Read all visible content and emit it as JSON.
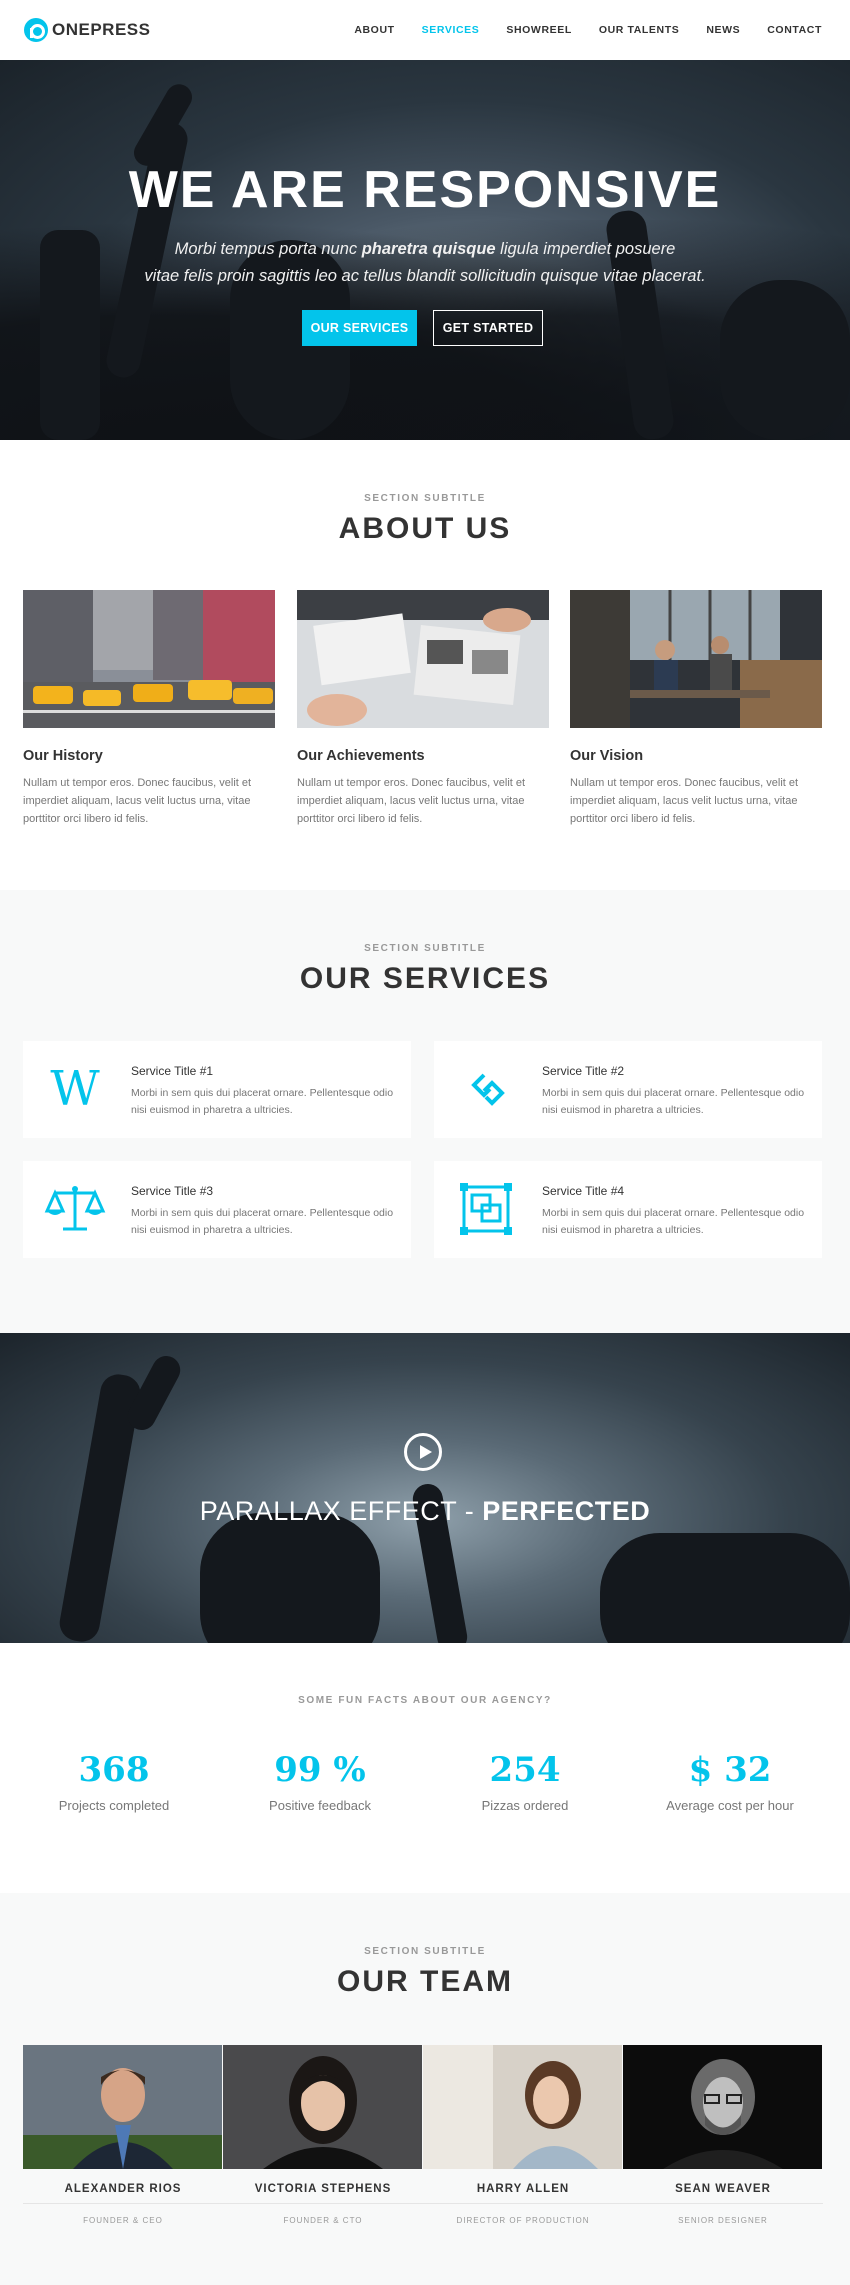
{
  "header": {
    "logo_text": "ONEPRESS",
    "nav": [
      "ABOUT",
      "SERVICES",
      "SHOWREEL",
      "OUR TALENTS",
      "NEWS",
      "CONTACT"
    ],
    "active_nav": "SERVICES"
  },
  "hero": {
    "title": "WE ARE RESPONSIVE",
    "sub_line1_a": "Morbi tempus porta nunc ",
    "sub_line1_b": "pharetra quisque",
    "sub_line1_c": " ligula imperdiet posuere",
    "sub_line2": "vitae felis proin sagittis leo ac tellus blandit sollicitudin quisque vitae placerat.",
    "btn_primary": "OUR SERVICES",
    "btn_secondary": "GET STARTED"
  },
  "about": {
    "subtitle": "SECTION SUBTITLE",
    "title": "ABOUT US",
    "cards": [
      {
        "title": "Our History",
        "text": "Nullam ut tempor eros. Donec faucibus, velit et imperdiet aliquam, lacus velit luctus urna, vitae porttitor orci libero id felis."
      },
      {
        "title": "Our Achievements",
        "text": "Nullam ut tempor eros. Donec faucibus, velit et imperdiet aliquam, lacus velit luctus urna, vitae porttitor orci libero id felis."
      },
      {
        "title": "Our Vision",
        "text": "Nullam ut tempor eros. Donec faucibus, velit et imperdiet aliquam, lacus velit luctus urna, vitae porttitor orci libero id felis."
      }
    ]
  },
  "services": {
    "subtitle": "SECTION SUBTITLE",
    "title": "OUR SERVICES",
    "items": [
      {
        "title": "Service Title #1",
        "text": "Morbi in sem quis dui placerat ornare. Pellentesque odio nisi euismod in pharetra a ultricies.",
        "icon": "wikipedia-icon"
      },
      {
        "title": "Service Title #2",
        "text": "Morbi in sem quis dui placerat ornare. Pellentesque odio nisi euismod in pharetra a ultricies.",
        "icon": "links-icon"
      },
      {
        "title": "Service Title #3",
        "text": "Morbi in sem quis dui placerat ornare. Pellentesque odio nisi euismod in pharetra a ultricies.",
        "icon": "balance-scale-icon"
      },
      {
        "title": "Service Title #4",
        "text": "Morbi in sem quis dui placerat ornare. Pellentesque odio nisi euismod in pharetra a ultricies.",
        "icon": "object-group-icon"
      }
    ]
  },
  "parallax": {
    "text_a": "PARALLAX EFFECT - ",
    "text_b": "PERFECTED"
  },
  "facts": {
    "subtitle": "SOME FUN FACTS ABOUT OUR AGENCY?",
    "items": [
      {
        "number": "368",
        "label": "Projects completed"
      },
      {
        "number": "99 %",
        "label": "Positive feedback"
      },
      {
        "number": "254",
        "label": "Pizzas ordered"
      },
      {
        "number": "$ 32",
        "label": "Average cost per hour"
      }
    ]
  },
  "team": {
    "subtitle": "SECTION SUBTITLE",
    "title": "OUR TEAM",
    "members": [
      {
        "name": "ALEXANDER RIOS",
        "role": "FOUNDER & CEO"
      },
      {
        "name": "VICTORIA STEPHENS",
        "role": "FOUNDER & CTO"
      },
      {
        "name": "HARRY ALLEN",
        "role": "DIRECTOR OF PRODUCTION"
      },
      {
        "name": "SEAN WEAVER",
        "role": "SENIOR DESIGNER"
      }
    ]
  },
  "colors": {
    "accent": "#03c4eb",
    "text": "#333333",
    "muted": "#777777",
    "section_bg": "#f8f9f9"
  }
}
